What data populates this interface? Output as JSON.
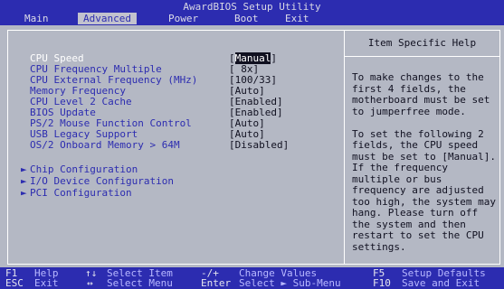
{
  "title": "AwardBIOS Setup Utility",
  "menu": [
    {
      "label": "Main",
      "active": false
    },
    {
      "label": "Advanced",
      "active": true
    },
    {
      "label": "Power",
      "active": false
    },
    {
      "label": "Boot",
      "active": false
    },
    {
      "label": "Exit",
      "active": false
    }
  ],
  "settings": [
    {
      "label": "CPU Speed",
      "value": "[Manual]",
      "selected": true
    },
    {
      "label": "CPU Frequency Multiple",
      "value": "[ 8x]"
    },
    {
      "label": "CPU External Frequency (MHz)",
      "value": "[100/33]"
    },
    {
      "label": "Memory Frequency",
      "value": "[Auto]"
    },
    {
      "label": "CPU Level 2 Cache",
      "value": "[Enabled]"
    },
    {
      "label": "BIOS Update",
      "value": "[Enabled]"
    },
    {
      "label": "PS/2 Mouse Function Control",
      "value": "[Auto]"
    },
    {
      "label": "USB Legacy Support",
      "value": "[Auto]"
    },
    {
      "label": "OS/2 Onboard Memory > 64M",
      "value": "[Disabled]"
    }
  ],
  "submenus": [
    {
      "arrow": "►",
      "label": "Chip Configuration"
    },
    {
      "arrow": "►",
      "label": "I/O Device Configuration"
    },
    {
      "arrow": "►",
      "label": "PCI Configuration"
    }
  ],
  "help": {
    "title": "Item Specific Help",
    "text": "To make changes to the\nfirst 4 fields, the\nmotherboard must be set\nto jumperfree mode.\n\nTo set the following 2\nfields, the CPU speed\nmust be set to [Manual].\nIf the frequency\nmultiple or bus\nfrequency are adjusted\ntoo high, the system may\nhang. Please turn off\nthe system and then\nrestart to set the CPU\nsettings."
  },
  "footer": {
    "row1": {
      "k1": "F1",
      "d1": "Help",
      "k2": "↑↓",
      "d2": "Select Item",
      "k3": "-/+",
      "d3": "Change Values",
      "k4": "F5",
      "d4": "Setup Defaults"
    },
    "row2": {
      "k1": "ESC",
      "d1": "Exit",
      "k2": "↔",
      "d2": "Select Menu",
      "k3": "Enter",
      "d3": "Select ► Sub-Menu",
      "k4": "F10",
      "d4": "Save and Exit"
    }
  },
  "colors": {
    "bar_blue": "#2c2cb0",
    "panel_gray": "#b4b8c4",
    "highlight": "#101020"
  }
}
